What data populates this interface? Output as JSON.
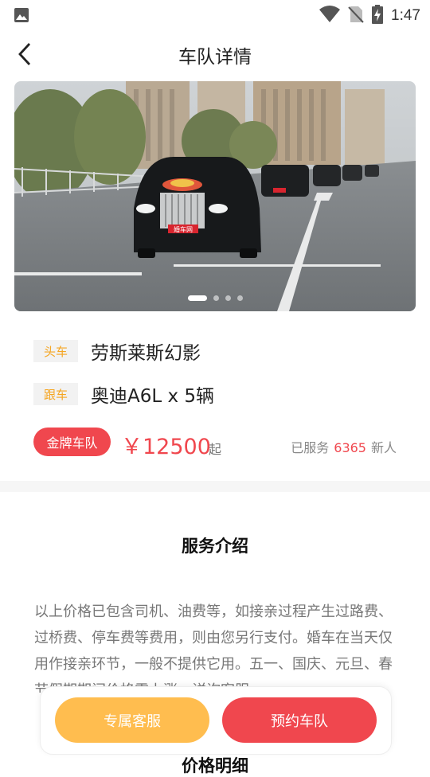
{
  "status_bar": {
    "time": "1:47",
    "icons": [
      "image-icon",
      "wifi-icon",
      "no-sim-icon",
      "battery-charging-icon"
    ]
  },
  "header": {
    "title": "车队详情",
    "back_icon": "chevron-left-icon"
  },
  "hero": {
    "plate_text": "婚车网",
    "slide_count": 4,
    "active_slide": 1
  },
  "fleet": {
    "lead": {
      "tag": "头车",
      "name": "劳斯莱斯幻影"
    },
    "follow": {
      "tag": "跟车",
      "name": "奥迪A6L x 5辆"
    }
  },
  "pricing": {
    "badge": "金牌车队",
    "price": "￥12500",
    "suffix": "起",
    "served_prefix": "已服务",
    "served_count": "6365",
    "served_suffix": "新人"
  },
  "intro": {
    "title": "服务介绍",
    "text": "以上价格已包含司机、油费等，如接亲过程产生过路费、过桥费、停车费等费用，则由您另行支付。婚车在当天仅用作接亲环节，一般不提供它用。五一、国庆、元旦、春节假期期间价格需上涨，详询客服。"
  },
  "price_detail": {
    "title": "价格明细"
  },
  "actions": {
    "service_label": "专属客服",
    "book_label": "预约车队"
  },
  "colors": {
    "accent_red": "#f0474e",
    "accent_orange": "#ffbd4f",
    "tag_text": "#f5a623"
  }
}
